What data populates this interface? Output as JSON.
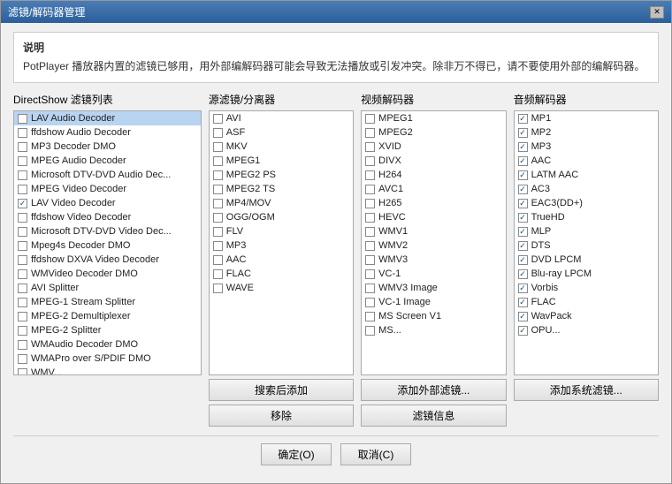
{
  "title": "滤镜/解码器管理",
  "notice": {
    "title": "说明",
    "text": "PotPlayer 播放器内置的滤镜已够用，用外部编解码器可能会导致无法播放或引发冲突。除非万不得已，请不要使用外部的编解码器。"
  },
  "directshow": {
    "title": "DirectShow 滤镜列表",
    "items": [
      {
        "label": "LAV Audio Decoder",
        "checked": false,
        "selected": true
      },
      {
        "label": "ffdshow Audio Decoder",
        "checked": false
      },
      {
        "label": "MP3 Decoder DMO",
        "checked": false
      },
      {
        "label": "MPEG Audio Decoder",
        "checked": false
      },
      {
        "label": "Microsoft DTV-DVD Audio Dec...",
        "checked": false
      },
      {
        "label": "MPEG Video Decoder",
        "checked": false
      },
      {
        "label": "LAV Video Decoder",
        "checked": true
      },
      {
        "label": "ffdshow Video Decoder",
        "checked": false
      },
      {
        "label": "Microsoft DTV-DVD Video Dec...",
        "checked": false
      },
      {
        "label": "Mpeg4s Decoder DMO",
        "checked": false
      },
      {
        "label": "ffdshow DXVA Video Decoder",
        "checked": false
      },
      {
        "label": "WMVideo Decoder DMO",
        "checked": false
      },
      {
        "label": "AVI Splitter",
        "checked": false
      },
      {
        "label": "MPEG-1 Stream Splitter",
        "checked": false
      },
      {
        "label": "MPEG-2 Demultiplexer",
        "checked": false
      },
      {
        "label": "MPEG-2 Splitter",
        "checked": false
      },
      {
        "label": "WMAudio Decoder DMO",
        "checked": false
      },
      {
        "label": "WMAPro over S/PDIF DMO",
        "checked": false
      },
      {
        "label": "WMV...",
        "checked": false
      }
    ]
  },
  "source": {
    "title": "源滤镜/分离器",
    "items": [
      {
        "label": "AVI",
        "checked": false
      },
      {
        "label": "ASF",
        "checked": false
      },
      {
        "label": "MKV",
        "checked": false
      },
      {
        "label": "MPEG1",
        "checked": false
      },
      {
        "label": "MPEG2 PS",
        "checked": false
      },
      {
        "label": "MPEG2 TS",
        "checked": false
      },
      {
        "label": "MP4/MOV",
        "checked": false
      },
      {
        "label": "OGG/OGM",
        "checked": false
      },
      {
        "label": "FLV",
        "checked": false
      },
      {
        "label": "MP3",
        "checked": false
      },
      {
        "label": "AAC",
        "checked": false
      },
      {
        "label": "FLAC",
        "checked": false
      },
      {
        "label": "WAVE",
        "checked": false
      }
    ],
    "buttons": [
      "搜索后添加",
      "移除"
    ]
  },
  "video": {
    "title": "视频解码器",
    "items": [
      {
        "label": "MPEG1",
        "checked": false
      },
      {
        "label": "MPEG2",
        "checked": false
      },
      {
        "label": "XVID",
        "checked": false
      },
      {
        "label": "DIVX",
        "checked": false
      },
      {
        "label": "H264",
        "checked": false
      },
      {
        "label": "AVC1",
        "checked": false
      },
      {
        "label": "H265",
        "checked": false
      },
      {
        "label": "HEVC",
        "checked": false
      },
      {
        "label": "WMV1",
        "checked": false
      },
      {
        "label": "WMV2",
        "checked": false
      },
      {
        "label": "WMV3",
        "checked": false
      },
      {
        "label": "VC-1",
        "checked": false
      },
      {
        "label": "WMV3 Image",
        "checked": false
      },
      {
        "label": "VC-1 Image",
        "checked": false
      },
      {
        "label": "MS Screen V1",
        "checked": false
      },
      {
        "label": "MS...",
        "checked": false
      }
    ],
    "buttons": [
      "添加外部滤镜...",
      "滤镜信息"
    ]
  },
  "audio": {
    "title": "音频解码器",
    "items": [
      {
        "label": "MP1",
        "checked": true
      },
      {
        "label": "MP2",
        "checked": true
      },
      {
        "label": "MP3",
        "checked": true
      },
      {
        "label": "AAC",
        "checked": true
      },
      {
        "label": "LATM AAC",
        "checked": true
      },
      {
        "label": "AC3",
        "checked": true
      },
      {
        "label": "EAC3(DD+)",
        "checked": true
      },
      {
        "label": "TrueHD",
        "checked": true
      },
      {
        "label": "MLP",
        "checked": true
      },
      {
        "label": "DTS",
        "checked": true
      },
      {
        "label": "DVD LPCM",
        "checked": true
      },
      {
        "label": "Blu-ray LPCM",
        "checked": true
      },
      {
        "label": "Vorbis",
        "checked": true
      },
      {
        "label": "FLAC",
        "checked": true
      },
      {
        "label": "WavPack",
        "checked": true
      },
      {
        "label": "OPU...",
        "checked": true
      }
    ],
    "buttons": [
      "添加系统滤镜..."
    ]
  },
  "footer": {
    "ok_label": "确定(O)",
    "cancel_label": "取消(C)"
  },
  "title_buttons": {
    "close": "✕"
  }
}
